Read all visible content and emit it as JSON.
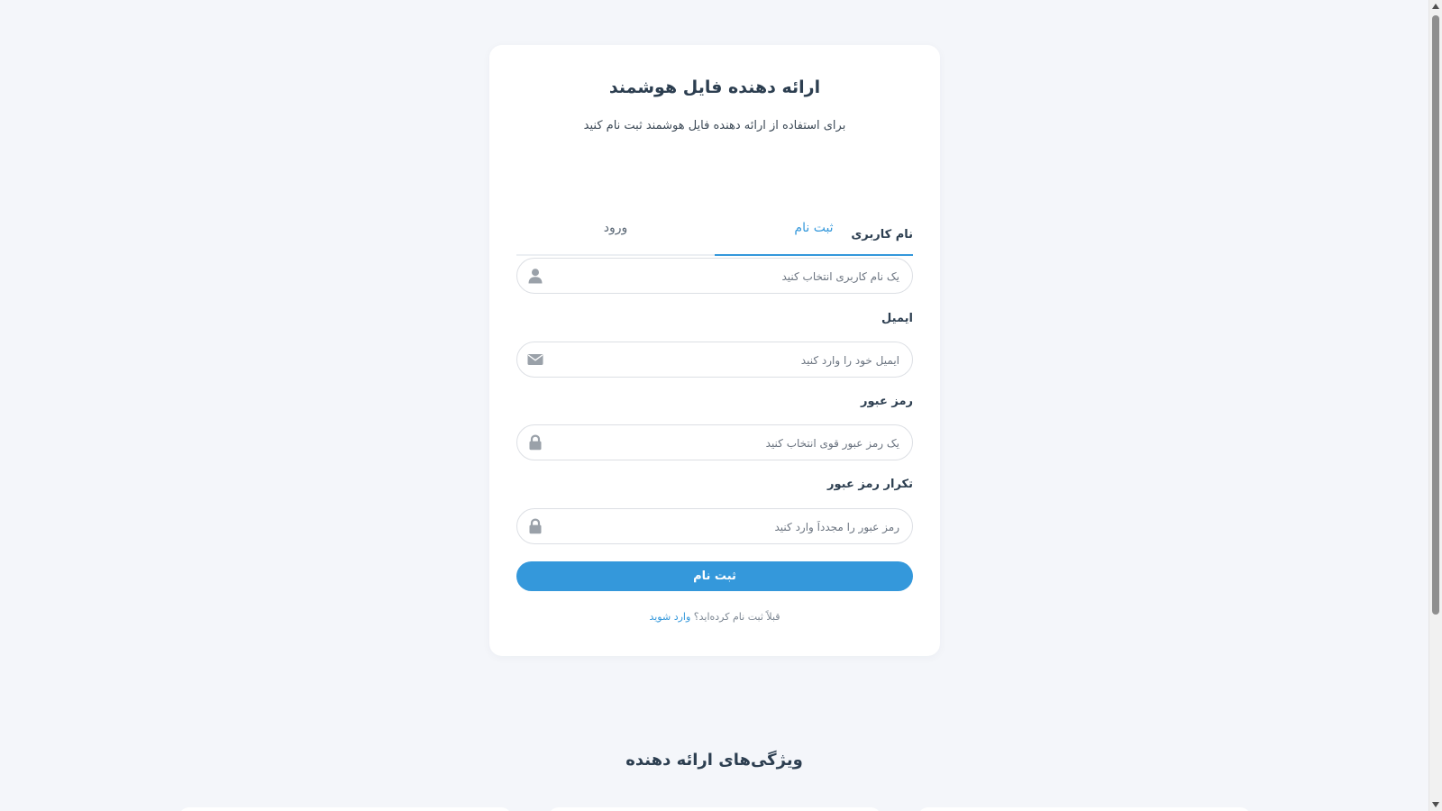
{
  "auth_card": {
    "title": "ارائه دهنده فایل هوشمند",
    "subtitle": "برای استفاده از ارائه دهنده فایل هوشمند ثبت نام کنید",
    "tabs": [
      {
        "label": "ثبت نام",
        "active": true
      },
      {
        "label": "ورود",
        "active": false
      }
    ],
    "fields": {
      "username": {
        "label": "نام کاربری",
        "placeholder": "یک نام کاربری انتخاب کنید",
        "value": "",
        "icon": "user-icon"
      },
      "email": {
        "label": "ایمیل",
        "placeholder": "ایمیل خود را وارد کنید",
        "value": "",
        "icon": "envelope-icon"
      },
      "password": {
        "label": "رمز عبور",
        "placeholder": "یک رمز عبور قوی انتخاب کنید",
        "value": "",
        "icon": "lock-icon"
      },
      "confirm_password": {
        "label": "تکرار رمز عبور",
        "placeholder": "رمز عبور را مجدداً وارد کنید",
        "value": "",
        "icon": "lock-icon"
      }
    },
    "submit_label": "ثبت نام",
    "switch_prompt": "قبلاً ثبت نام کرده‌اید؟",
    "switch_link": "وارد شوید"
  },
  "features": {
    "title": "ویژگی‌های ارائه دهنده"
  },
  "colors": {
    "accent": "#3498db",
    "background": "#f4f6fa",
    "card": "#ffffff",
    "text": "#2c3e50",
    "icon": "#9aa1a9"
  }
}
